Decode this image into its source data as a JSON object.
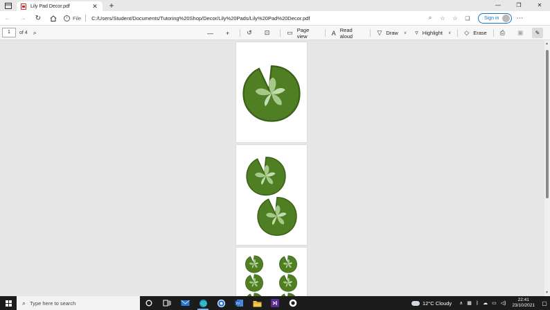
{
  "browser": {
    "tab_title": "Lily Pad Decor.pdf",
    "file_label": "File",
    "url": "C:/Users/Student/Documents/Tutoring%20Shop/Decor/Lily%20Pads/Lily%20Pad%20Decor.pdf",
    "signin_label": "Sign in"
  },
  "pdf_toolbar": {
    "current_page": "1",
    "page_count_label": "of 4",
    "page_view_label": "Page view",
    "read_aloud_label": "Read aloud",
    "draw_label": "Draw",
    "highlight_label": "Highlight",
    "erase_label": "Erase"
  },
  "colors": {
    "pad_fill": "#4f7f22",
    "pad_edge": "#3b6117",
    "vein": "#a5c98a",
    "vein_light": "#c4dcb0"
  },
  "taskbar": {
    "search_placeholder": "Type here to search",
    "weather": "12°C  Cloudy",
    "time": "22:41",
    "date": "23/10/2021"
  }
}
